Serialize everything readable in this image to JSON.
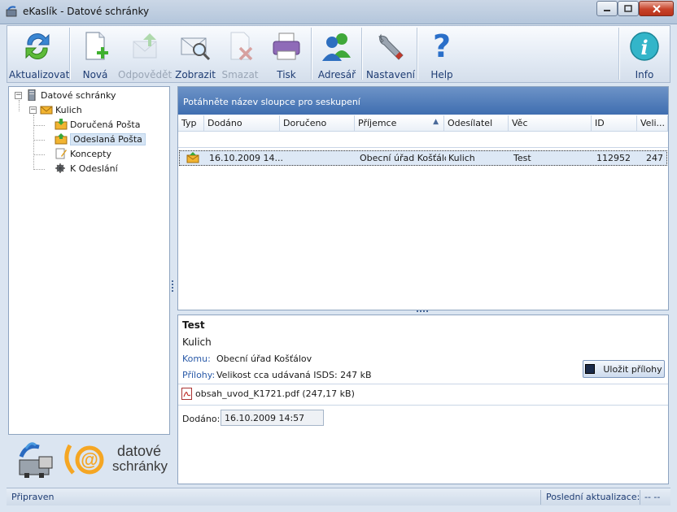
{
  "window": {
    "title": "eKaslík - Datové schránky"
  },
  "toolbar": {
    "buttons": [
      {
        "label": "Aktualizovat",
        "icon": "refresh-arrows-icon",
        "enabled": true
      },
      {
        "label": "Nová",
        "icon": "new-document-icon",
        "enabled": true
      },
      {
        "label": "Odpovědět",
        "icon": "reply-icon",
        "enabled": false
      },
      {
        "label": "Zobrazit",
        "icon": "view-envelope-icon",
        "enabled": true
      },
      {
        "label": "Smazat",
        "icon": "delete-icon",
        "enabled": false
      },
      {
        "label": "Tisk",
        "icon": "printer-icon",
        "enabled": true
      },
      {
        "label": "Adresář",
        "icon": "address-book-people-icon",
        "enabled": true
      },
      {
        "label": "Nastavení",
        "icon": "wrench-icon",
        "enabled": true
      },
      {
        "label": "Help",
        "icon": "help-question-icon",
        "enabled": true
      },
      {
        "label": "Info",
        "icon": "info-icon",
        "enabled": true
      }
    ]
  },
  "tree": {
    "root": "Datové schránky",
    "box": "Kulich",
    "folders": [
      {
        "label": "Doručená Pošta",
        "icon": "inbox-icon"
      },
      {
        "label": "Odeslaná Pošta",
        "icon": "sent-mail-icon",
        "selected": true
      },
      {
        "label": "Koncepty",
        "icon": "draft-icon"
      },
      {
        "label": "K Odeslání",
        "icon": "outbox-gear-icon"
      }
    ]
  },
  "logos": {
    "line1": "datové",
    "line2": "schránky"
  },
  "grid": {
    "group_hint": "Potáhněte název sloupce pro seskupení",
    "columns": [
      "Typ",
      "Dodáno",
      "Doručeno",
      "Příjemce",
      "Odesílatel",
      "Věc",
      "ID",
      "Veli..."
    ],
    "sorted_column": "Příjemce",
    "rows": [
      {
        "typ_icon": "sent-envelope-icon",
        "dodano": "16.10.2009  14...",
        "doruceno": "",
        "prijemce": "Obecní úřad Košťálov",
        "odesilatel": "Kulich",
        "vec": "Test",
        "id": "112952",
        "velikost": "247"
      }
    ]
  },
  "detail": {
    "subject": "Test",
    "sender": "Kulich",
    "komu_label": "Komu:",
    "komu_value": "Obecní úřad Košťálov",
    "prilohy_label": "Přílohy:",
    "prilohy_value": "Velikost cca udávaná ISDS: 247 kB",
    "save_button": "Uložit přílohy",
    "attachment": "obsah_uvod_K1721.pdf (247,17 kB)",
    "dodano_label": "Dodáno:",
    "dodano_value": "16.10.2009 14:57"
  },
  "status": {
    "left": "Připraven",
    "last_update_label": "Poslední aktualizace:",
    "last_update_value": "-- --"
  }
}
